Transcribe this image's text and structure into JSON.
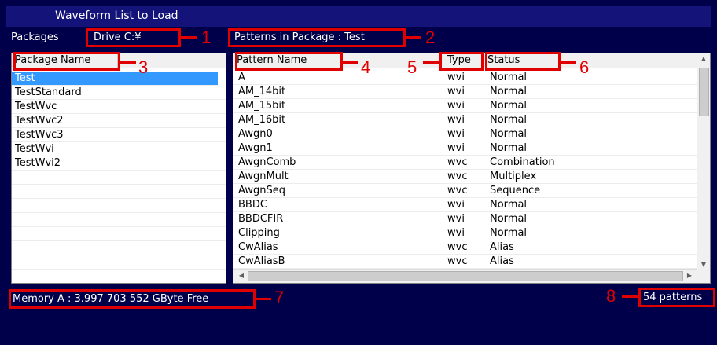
{
  "window": {
    "title": "Waveform List to Load"
  },
  "packages": {
    "label": "Packages",
    "drive": "Drive C:¥",
    "column_header": "Package Name",
    "items": [
      "Test",
      "TestStandard",
      "TestWvc",
      "TestWvc2",
      "TestWvc3",
      "TestWvi",
      "TestWvi2"
    ],
    "selected_index": 0
  },
  "patterns": {
    "label": "Patterns in Package : Test",
    "columns": {
      "name": "Pattern Name",
      "type": "Type",
      "status": "Status"
    },
    "rows": [
      {
        "name": "A",
        "type": "wvi",
        "status": "Normal"
      },
      {
        "name": "AM_14bit",
        "type": "wvi",
        "status": "Normal"
      },
      {
        "name": "AM_15bit",
        "type": "wvi",
        "status": "Normal"
      },
      {
        "name": "AM_16bit",
        "type": "wvi",
        "status": "Normal"
      },
      {
        "name": "Awgn0",
        "type": "wvi",
        "status": "Normal"
      },
      {
        "name": "Awgn1",
        "type": "wvi",
        "status": "Normal"
      },
      {
        "name": "AwgnComb",
        "type": "wvc",
        "status": "Combination"
      },
      {
        "name": "AwgnMult",
        "type": "wvc",
        "status": "Multiplex"
      },
      {
        "name": "AwgnSeq",
        "type": "wvc",
        "status": "Sequence"
      },
      {
        "name": "BBDC",
        "type": "wvi",
        "status": "Normal"
      },
      {
        "name": "BBDCFIR",
        "type": "wvi",
        "status": "Normal"
      },
      {
        "name": "Clipping",
        "type": "wvi",
        "status": "Normal"
      },
      {
        "name": "CwAlias",
        "type": "wvc",
        "status": "Alias"
      },
      {
        "name": "CwAliasB",
        "type": "wvc",
        "status": "Alias"
      }
    ],
    "count_text": "54 patterns"
  },
  "memory": {
    "text": "Memory A :  3.997 703 552 GByte Free"
  },
  "callouts": [
    "1",
    "2",
    "3",
    "4",
    "5",
    "6",
    "7",
    "8"
  ],
  "colors": {
    "background": "#00004a",
    "title_bar": "#13137a",
    "selection": "#3399ff",
    "callout": "#e10000"
  }
}
